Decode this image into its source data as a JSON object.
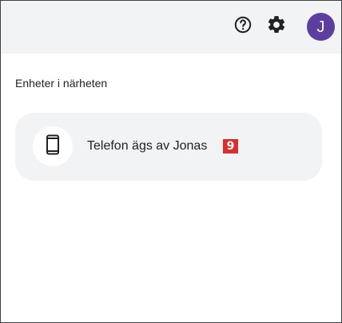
{
  "header": {
    "help_icon": "help-circle-icon",
    "settings_icon": "gear-icon",
    "avatar_initial": "J",
    "avatar_color": "#5b3e9e"
  },
  "nearby": {
    "section_title": "Enheter i närheten",
    "devices": [
      {
        "icon": "phone-icon",
        "name": "Telefon ägs av Jonas",
        "badge": "9",
        "badge_color": "#d92f2f"
      }
    ]
  }
}
